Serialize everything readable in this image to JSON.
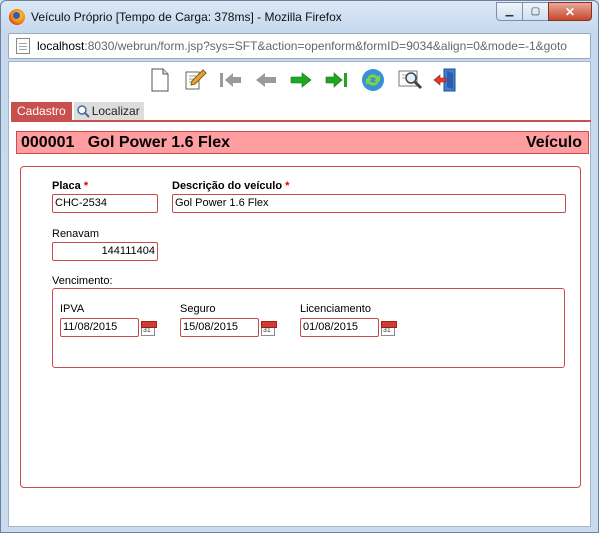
{
  "window": {
    "title": "Veículo Próprio [Tempo de Carga: 378ms] - Mozilla Firefox",
    "min_label": "▁",
    "max_label": "▢",
    "close_label": "✕"
  },
  "address": {
    "host": "localhost",
    "path": ":8030/webrun/form.jsp?sys=SFT&action=openform&formID=9034&align=0&mode=-1&goto"
  },
  "toolbar": {
    "icons": [
      "new-document-icon",
      "edit-icon",
      "first-record-icon",
      "previous-record-icon",
      "next-record-icon",
      "last-record-icon",
      "refresh-icon",
      "search-icon",
      "exit-icon"
    ]
  },
  "tabs": {
    "cadastro": "Cadastro",
    "localizar": "Localizar"
  },
  "header": {
    "code": "000001",
    "name": "Gol Power 1.6 Flex",
    "entity": "Veículo"
  },
  "form": {
    "placa_label": "Placa",
    "placa_value": "CHC-2534",
    "descricao_label": "Descrição do veículo",
    "descricao_value": "Gol Power 1.6 Flex",
    "required_mark": "*",
    "renavam_label": "Renavam",
    "renavam_value": "144111404",
    "vencimento_label": "Vencimento:",
    "ipva_label": "IPVA",
    "ipva_value": "11/08/2015",
    "seguro_label": "Seguro",
    "seguro_value": "15/08/2015",
    "licenciamento_label": "Licenciamento",
    "licenciamento_value": "01/08/2015"
  },
  "colors": {
    "accent_red": "#c8504e",
    "header_bg": "#ff9ea1",
    "arrow_green": "#1fa81f",
    "arrow_gray": "#9a9a9a"
  }
}
